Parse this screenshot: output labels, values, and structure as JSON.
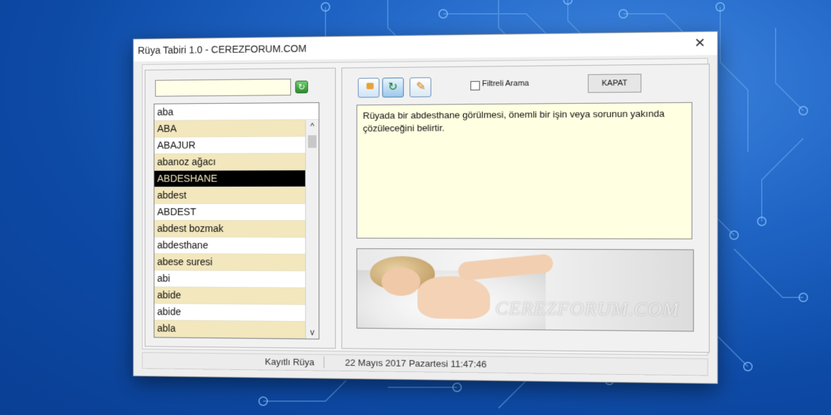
{
  "window": {
    "title": "Rüya Tabiri 1.0 - CEREZFORUM.COM",
    "close_glyph": "✕"
  },
  "search": {
    "value": "",
    "placeholder": ""
  },
  "icons": {
    "refresh_small": "↻"
  },
  "dream_list": {
    "items": [
      {
        "label": "aba",
        "style": "even"
      },
      {
        "label": "ABA",
        "style": "odd"
      },
      {
        "label": "ABAJUR",
        "style": "even"
      },
      {
        "label": "abanoz ağacı",
        "style": "odd"
      },
      {
        "label": "ABDESHANE",
        "style": "selected"
      },
      {
        "label": "abdest",
        "style": "odd"
      },
      {
        "label": "ABDEST",
        "style": "even"
      },
      {
        "label": "abdest bozmak",
        "style": "odd"
      },
      {
        "label": "abdesthane",
        "style": "even"
      },
      {
        "label": "abese suresi",
        "style": "odd"
      },
      {
        "label": "abi",
        "style": "even"
      },
      {
        "label": "abide",
        "style": "odd"
      },
      {
        "label": "abide",
        "style": "even"
      },
      {
        "label": "abla",
        "style": "odd"
      }
    ],
    "scroll_up": "^",
    "scroll_down": "v"
  },
  "toolbar": {
    "filter_label": "Filtreli Arama",
    "filter_checked": false,
    "close_button": "KAPAT"
  },
  "description": "Rüyada bir abdesthane görülmesi, önemli bir işin veya sorunun yakında çözüleceğini belirtir.",
  "image": {
    "watermark": "CEREZFORUM.COM"
  },
  "status": {
    "label": "Kayıtlı Rüya",
    "datetime": "22 Mayıs 2017 Pazartesi 11:47:46"
  },
  "colors": {
    "list_odd": "#f2e7bd",
    "list_selected": "#000000",
    "desc_bg": "#ffffe2"
  }
}
